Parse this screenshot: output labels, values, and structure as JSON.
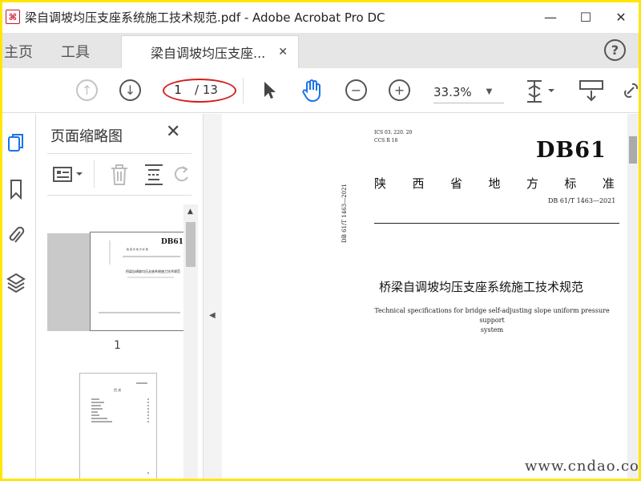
{
  "window": {
    "title": "梁自调坡均压支座系统施工技术规范.pdf - Adobe Acrobat Pro DC",
    "app_icon": "acrobat-icon",
    "minimize": "—",
    "maximize": "☐",
    "close": "✕"
  },
  "tabs": {
    "home": "主页",
    "tools": "工具",
    "document": "梁自调坡均压支座...",
    "close": "✕",
    "help": "?"
  },
  "toolbar": {
    "page_current": "1",
    "page_total": "/ 13",
    "zoom": "33.3%"
  },
  "panel": {
    "title": "页面缩略图",
    "close": "✕",
    "thumbnails": [
      {
        "label": "1"
      }
    ]
  },
  "document": {
    "ics_line1": "ICS 03. 220. 20",
    "ics_line2": "CCS R 18",
    "big_code": "DB61",
    "standard_type_chars": [
      "陕",
      "西",
      "省",
      "地",
      "方",
      "标",
      "准"
    ],
    "standard_number": "DB 61/T 1463—2021",
    "side_number": "DB 61/T 1463—2021",
    "title_cn": "桥梁自调坡均压支座系统施工技术规范",
    "title_en_line1": "Technical specifications for bridge self-adjusting slope uniform pressure support",
    "title_en_line2": "system"
  },
  "watermark": "www.cndao.com",
  "colors": {
    "frame_border": "#ffe600",
    "annotation_ellipse": "#d42020",
    "active_tool": "#1a73e8"
  }
}
